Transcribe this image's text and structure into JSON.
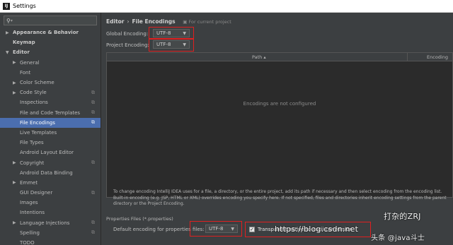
{
  "window": {
    "title": "Settings",
    "app_icon_text": "IJ"
  },
  "search": {
    "icon": "search-icon",
    "value": ""
  },
  "sidebar": {
    "items": [
      {
        "label": "Appearance & Behavior",
        "level": 0,
        "arrow": "▶",
        "bold": true
      },
      {
        "label": "Keymap",
        "level": 0,
        "arrow": "",
        "bold": true
      },
      {
        "label": "Editor",
        "level": 0,
        "arrow": "▼",
        "bold": true
      },
      {
        "label": "General",
        "level": 1,
        "arrow": "▶"
      },
      {
        "label": "Font",
        "level": 1,
        "arrow": ""
      },
      {
        "label": "Color Scheme",
        "level": 1,
        "arrow": "▶"
      },
      {
        "label": "Code Style",
        "level": 1,
        "arrow": "▶",
        "copy": "⧉"
      },
      {
        "label": "Inspections",
        "level": 1,
        "arrow": "",
        "copy": "⧉"
      },
      {
        "label": "File and Code Templates",
        "level": 1,
        "arrow": "",
        "copy": "⧉"
      },
      {
        "label": "File Encodings",
        "level": 1,
        "arrow": "",
        "copy": "⧉",
        "selected": true
      },
      {
        "label": "Live Templates",
        "level": 1,
        "arrow": ""
      },
      {
        "label": "File Types",
        "level": 1,
        "arrow": ""
      },
      {
        "label": "Android Layout Editor",
        "level": 1,
        "arrow": ""
      },
      {
        "label": "Copyright",
        "level": 1,
        "arrow": "▶",
        "copy": "⧉"
      },
      {
        "label": "Android Data Binding",
        "level": 1,
        "arrow": ""
      },
      {
        "label": "Emmet",
        "level": 1,
        "arrow": "▶"
      },
      {
        "label": "GUI Designer",
        "level": 1,
        "arrow": "",
        "copy": "⧉"
      },
      {
        "label": "Images",
        "level": 1,
        "arrow": ""
      },
      {
        "label": "Intentions",
        "level": 1,
        "arrow": ""
      },
      {
        "label": "Language Injections",
        "level": 1,
        "arrow": "▶",
        "copy": "⧉"
      },
      {
        "label": "Spelling",
        "level": 1,
        "arrow": "",
        "copy": "⧉"
      },
      {
        "label": "TODO",
        "level": 1,
        "arrow": ""
      }
    ]
  },
  "breadcrumb": {
    "section": "Editor",
    "separator": "›",
    "page": "File Encodings",
    "hint": "For current project",
    "hint_icon": "project-icon"
  },
  "global_encoding": {
    "label": "Global Encoding:",
    "value": "UTF-8"
  },
  "project_encoding": {
    "label": "Project Encoding:",
    "value": "UTF-8"
  },
  "table": {
    "columns": [
      "Path ▴",
      "Encoding"
    ],
    "empty_text": "Encodings are not configured"
  },
  "info_text": "To change encoding IntelliJ IDEA uses for a file, a directory, or the entire project, add its path if necessary and then select encoding from the encoding list. Built-in encoding (e.g. JSP, HTML or XML) overrides encoding you specify here. If not specified, files and directories inherit encoding settings from the parent directory or the Project Encoding.",
  "properties": {
    "section_title": "Properties Files (*.properties)",
    "default_label": "Default encoding for properties files:",
    "default_value": "UTF-8",
    "transparent_label": "Transparent native-to-ascii conversion",
    "transparent_checked": true
  },
  "watermark": {
    "left": "https://blog.csdn.net",
    "right": "头条 @java斗士",
    "top": "打杂的ZRJ"
  },
  "colors": {
    "background": "#3c3f41",
    "selection": "#4b6eaf",
    "highlight_box": "#e02020"
  }
}
